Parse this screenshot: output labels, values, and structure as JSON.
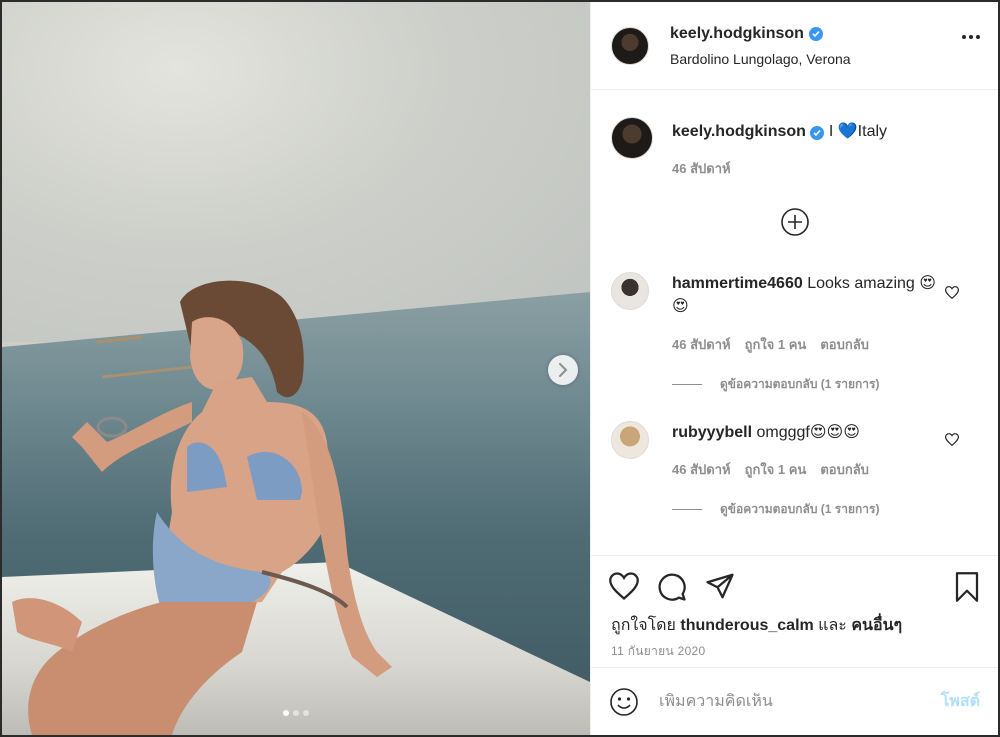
{
  "post": {
    "username": "keely.hodgkinson",
    "location": "Bardolino Lungolago, Verona",
    "caption_prefix": "I ",
    "caption_heart": "💙",
    "caption_suffix": "Italy",
    "caption_time": "46 สัปดาห์",
    "photo_index": "1",
    "photo_count": "3"
  },
  "comments": [
    {
      "username": "hammertime4660",
      "text": "Looks amazing 😍😍",
      "time": "46 สัปดาห์",
      "likes": "ถูกใจ 1 คน",
      "reply_label": "ตอบกลับ",
      "view_replies": "ดูข้อความตอบกลับ (1 รายการ)"
    },
    {
      "username": "rubyyybell",
      "text": "omgggf😍😍😍",
      "time": "46 สัปดาห์",
      "likes": "ถูกใจ 1 คน",
      "reply_label": "ตอบกลับ",
      "view_replies": "ดูข้อความตอบกลับ (1 รายการ)"
    }
  ],
  "footer": {
    "liked_by_prefix": "ถูกใจโดย ",
    "liked_by_user": "thunderous_calm",
    "liked_by_and": " และ ",
    "liked_by_others": "คนอื่นๆ",
    "date": "11 กันยายน 2020",
    "comment_placeholder": "เพิ่มความคิดเห็น",
    "post_label": "โพสต์"
  },
  "colors": {
    "verified": "#3897f0",
    "post_button_disabled": "#b2dffc",
    "muted_text": "#8e8e8e"
  },
  "icons": [
    "verified-badge-icon",
    "more-options-icon",
    "plus-circle-icon",
    "heart-icon",
    "comment-icon",
    "share-icon",
    "bookmark-icon",
    "emoji-icon",
    "chevron-right-icon"
  ]
}
